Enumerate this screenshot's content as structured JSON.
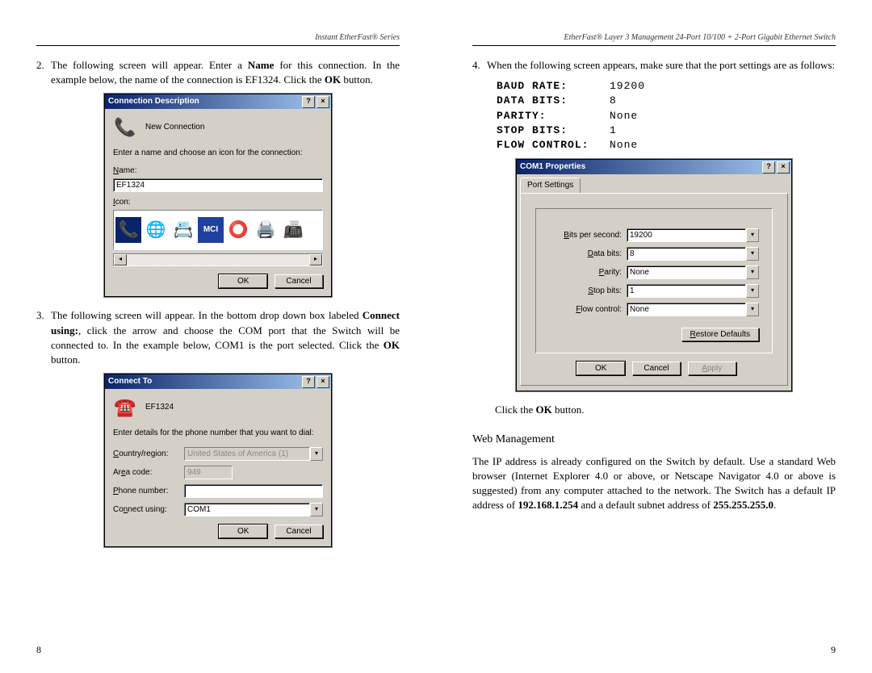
{
  "left_page": {
    "header": "Instant EtherFast® Series",
    "page_number": "8",
    "step2": {
      "num": "2.",
      "text_before_name": "The following screen will appear.  Enter a ",
      "name_word": "Name",
      "text_after_name": " for this connection.  In the example below, the name of the connection is EF1324.  Click the ",
      "ok_word": "OK",
      "text_after_ok": " button."
    },
    "step3": {
      "num": "3.",
      "line1": "The following screen will appear.  In the bottom drop down box labeled ",
      "connect_using": "Connect using:",
      "line2": ", click the arrow and choose the COM port that the Switch will be connected to.  In the example below, COM1 is the port selected. Click the ",
      "ok_word": "OK",
      "line3": " button."
    }
  },
  "right_page": {
    "header": "EtherFast® Layer 3 Management 24-Port 10/100 + 2-Port Gigabit Ethernet Switch",
    "page_number": "9",
    "step4": {
      "num": "4.",
      "text": "When the following screen appears, make sure that the port settings are as follows:"
    },
    "port_settings": [
      {
        "label": "BAUD RATE:",
        "value": "19200"
      },
      {
        "label": "DATA BITS:",
        "value": "8"
      },
      {
        "label": "PARITY:",
        "value": "None"
      },
      {
        "label": "STOP BITS:",
        "value": "1"
      },
      {
        "label": "FLOW CONTROL:",
        "value": "None"
      }
    ],
    "click_ok": {
      "pre": "Click the ",
      "ok": "OK",
      "post": " button."
    },
    "web_heading": "Web Management",
    "web_para": {
      "t1": "The IP address is already configured on the Switch by default. Use a standard Web browser (Internet Explorer 4.0 or above, or Netscape Navigator 4.0 or above is suggested) from any computer attached to the network. The Switch has a default IP address of ",
      "ip": "192.168.1.254",
      "t2": " and a default subnet address of ",
      "subnet": "255.255.255.0",
      "t3": "."
    }
  },
  "dlg_conn_desc": {
    "title": "Connection Description",
    "new_conn": "New Connection",
    "instr": "Enter a name and choose an icon for the connection:",
    "name_label": "Name:",
    "name_value": "EF1324",
    "icon_label": "Icon:",
    "ok": "OK",
    "cancel": "Cancel"
  },
  "dlg_connect_to": {
    "title": "Connect To",
    "conn_name": "EF1324",
    "instr": "Enter details for the phone number that you want to dial:",
    "country_label": "Country/region:",
    "country_value": "United States of America (1)",
    "area_label": "Area code:",
    "area_value": "949",
    "phone_label": "Phone number:",
    "phone_value": "",
    "connect_label": "Connect using:",
    "connect_value": "COM1",
    "ok": "OK",
    "cancel": "Cancel"
  },
  "dlg_com1": {
    "title": "COM1 Properties",
    "tab": "Port Settings",
    "fields": {
      "bps_label": "Bits per second:",
      "bps_value": "19200",
      "data_label": "Data bits:",
      "data_value": "8",
      "parity_label": "Parity:",
      "parity_value": "None",
      "stop_label": "Stop bits:",
      "stop_value": "1",
      "flow_label": "Flow control:",
      "flow_value": "None"
    },
    "restore": "Restore Defaults",
    "ok": "OK",
    "cancel": "Cancel",
    "apply": "Apply"
  }
}
